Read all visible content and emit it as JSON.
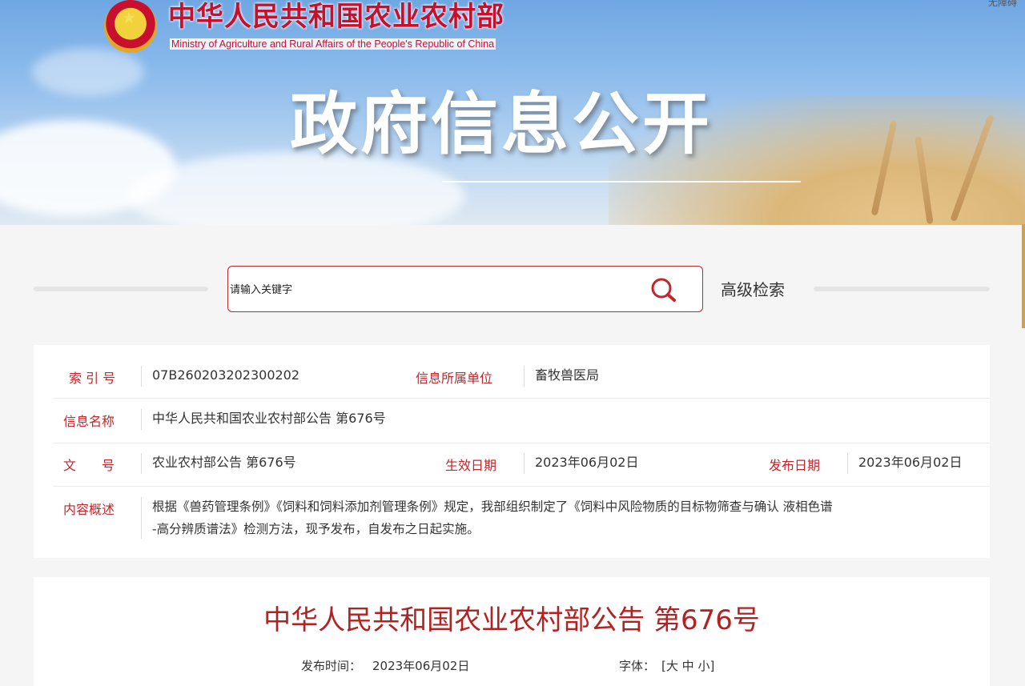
{
  "header": {
    "ministry_cn": "中华人民共和国农业农村部",
    "ministry_en": "Ministry of Agriculture and Rural Affairs of the People's Republic of China",
    "top_link": "无障碍",
    "banner_title": "政府信息公开"
  },
  "search": {
    "placeholder": "请输入关键字",
    "advanced": "高级检索"
  },
  "info": {
    "index_label": "索 引 号",
    "index_value": "07B260203202300202",
    "unit_label": "信息所属单位",
    "unit_value": "畜牧兽医局",
    "name_label": "信息名称",
    "name_value": "中华人民共和国农业农村部公告 第676号",
    "doc_label": "文　　号",
    "doc_value": "农业农村部公告 第676号",
    "effective_label": "生效日期",
    "effective_value": "2023年06月02日",
    "publish_label": "发布日期",
    "publish_value": "2023年06月02日",
    "summary_label": "内容概述",
    "summary_line1": "根据《兽药管理条例》《饲料和饲料添加剂管理条例》规定，我部组织制定了《饲料中风险物质的目标物筛查与确认 液相色谱",
    "summary_line2": "-高分辨质谱法》检测方法，现予发布，自发布之日起实施。"
  },
  "article": {
    "title": "中华人民共和国农业农村部公告 第676号",
    "time_label": "发布时间：",
    "time_value": "2023年06月02日",
    "font_label": "字体：",
    "font_open": "[",
    "font_large": "大",
    "font_medium": "中",
    "font_small": "小",
    "font_close": "]"
  },
  "colors": {
    "accent": "#c0262c",
    "title_red": "#b22222"
  }
}
